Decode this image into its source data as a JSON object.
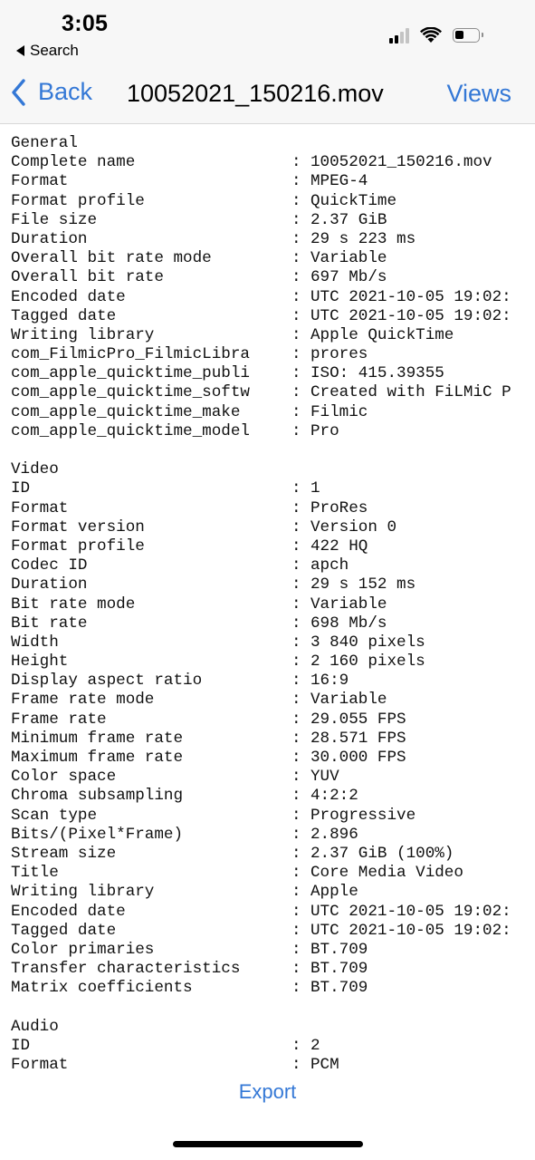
{
  "status_bar": {
    "time": "3:05",
    "back_to_app": "Search",
    "icons": [
      "cellular-signal-icon",
      "wifi-icon",
      "battery-icon"
    ],
    "signal_bars_active": 2,
    "signal_bars_total": 4,
    "battery_level": 0.3
  },
  "navbar": {
    "back_label": "Back",
    "title": "10052021_150216.mov",
    "views_label": "Views"
  },
  "colors": {
    "accent": "#3478d6",
    "header_bg": "#f7f7f7",
    "text": "#111111"
  },
  "sections": [
    {
      "title": "General",
      "rows": [
        {
          "label": "Complete name",
          "value": "10052021_150216.mov"
        },
        {
          "label": "Format",
          "value": "MPEG-4"
        },
        {
          "label": "Format profile",
          "value": "QuickTime"
        },
        {
          "label": "File size",
          "value": "2.37 GiB"
        },
        {
          "label": "Duration",
          "value": "29 s 223 ms"
        },
        {
          "label": "Overall bit rate mode",
          "value": "Variable"
        },
        {
          "label": "Overall bit rate",
          "value": "697 Mb/s"
        },
        {
          "label": "Encoded date",
          "value": "UTC 2021-10-05 19:02:"
        },
        {
          "label": "Tagged date",
          "value": "UTC 2021-10-05 19:02:"
        },
        {
          "label": "Writing library",
          "value": "Apple QuickTime"
        },
        {
          "label": "com_FilmicPro_FilmicLibra",
          "value": "prores"
        },
        {
          "label": "com_apple_quicktime_publi",
          "value": "ISO: 415.39355"
        },
        {
          "label": "com_apple_quicktime_softw",
          "value": "Created with FiLMiC P"
        },
        {
          "label": "com_apple_quicktime_make",
          "value": "Filmic"
        },
        {
          "label": "com_apple_quicktime_model",
          "value": "Pro"
        }
      ]
    },
    {
      "title": "Video",
      "rows": [
        {
          "label": "ID",
          "value": "1"
        },
        {
          "label": "Format",
          "value": "ProRes"
        },
        {
          "label": "Format version",
          "value": "Version 0"
        },
        {
          "label": "Format profile",
          "value": "422 HQ"
        },
        {
          "label": "Codec ID",
          "value": "apch"
        },
        {
          "label": "Duration",
          "value": "29 s 152 ms"
        },
        {
          "label": "Bit rate mode",
          "value": "Variable"
        },
        {
          "label": "Bit rate",
          "value": "698 Mb/s"
        },
        {
          "label": "Width",
          "value": "3 840 pixels"
        },
        {
          "label": "Height",
          "value": "2 160 pixels"
        },
        {
          "label": "Display aspect ratio",
          "value": "16:9"
        },
        {
          "label": "Frame rate mode",
          "value": "Variable"
        },
        {
          "label": "Frame rate",
          "value": "29.055 FPS"
        },
        {
          "label": "Minimum frame rate",
          "value": "28.571 FPS"
        },
        {
          "label": "Maximum frame rate",
          "value": "30.000 FPS"
        },
        {
          "label": "Color space",
          "value": "YUV"
        },
        {
          "label": "Chroma subsampling",
          "value": "4:2:2"
        },
        {
          "label": "Scan type",
          "value": "Progressive"
        },
        {
          "label": "Bits/(Pixel*Frame)",
          "value": "2.896"
        },
        {
          "label": "Stream size",
          "value": "2.37 GiB (100%)"
        },
        {
          "label": "Title",
          "value": "Core Media Video"
        },
        {
          "label": "Writing library",
          "value": "Apple"
        },
        {
          "label": "Encoded date",
          "value": "UTC 2021-10-05 19:02:"
        },
        {
          "label": "Tagged date",
          "value": "UTC 2021-10-05 19:02:"
        },
        {
          "label": "Color primaries",
          "value": "BT.709"
        },
        {
          "label": "Transfer characteristics",
          "value": "BT.709"
        },
        {
          "label": "Matrix coefficients",
          "value": "BT.709"
        }
      ]
    },
    {
      "title": "Audio",
      "rows": [
        {
          "label": "ID",
          "value": "2"
        },
        {
          "label": "Format",
          "value": "PCM"
        }
      ]
    }
  ],
  "separator": ":",
  "footer": {
    "export_label": "Export"
  }
}
